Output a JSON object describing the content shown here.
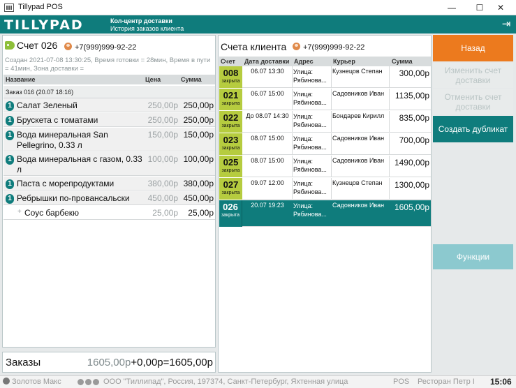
{
  "window": {
    "title": "Tillypad POS",
    "minimize": "—",
    "maximize": "☐",
    "close": "✕"
  },
  "header": {
    "logo": "TILLYPAD",
    "line1": "Кол-центр доставки",
    "line2": "История заказов клиента"
  },
  "left": {
    "bill_title": "Счет 026",
    "phone": "+7(999)999-92-22",
    "info": "Создан  2021-07-08 13:30:25, Время готовки = 28мин, Время в пути = 41мин, Зона доставки =",
    "columns": {
      "name": "Название",
      "price": "Цена",
      "sum": "Сумма"
    },
    "order_group": "Заказ 016 (20.07 18:16)",
    "items": [
      {
        "qty": "1",
        "name": "Салат Зеленый",
        "price": "250,00р",
        "sum": "250,00р"
      },
      {
        "qty": "1",
        "name": "Брускета с томатами",
        "price": "250,00р",
        "sum": "250,00р"
      },
      {
        "qty": "1",
        "name": "Вода минеральная San Pellegrino, 0.33 л",
        "price": "150,00р",
        "sum": "150,00р"
      },
      {
        "qty": "1",
        "name": "Вода минеральная с газом, 0.33 л",
        "price": "100,00р",
        "sum": "100,00р"
      },
      {
        "qty": "1",
        "name": "Паста с морепродуктами",
        "price": "380,00р",
        "sum": "380,00р"
      },
      {
        "qty": "1",
        "name": "Ребрышки по-провансальски",
        "price": "450,00р",
        "sum": "450,00р"
      }
    ],
    "modifier": {
      "plus": "+",
      "name": "Соус барбекю",
      "price": "25,00р",
      "sum": "25,00р"
    },
    "totals": {
      "label": "Заказы",
      "a": "1605,00р",
      "plus": "+",
      "b": "0,00р",
      "eq": "=",
      "total": "1605,00р"
    }
  },
  "mid": {
    "title": "Счета клиента",
    "phone": "+7(999)999-92-22",
    "columns": {
      "bill": "Счет",
      "date": "Дата доставки",
      "addr": "Адрес",
      "courier": "Курьер",
      "sum": "Сумма"
    },
    "bills": [
      {
        "num": "008",
        "state": "закрыта",
        "date": "06.07 13:30",
        "addr": "Улица: Рябинова...",
        "courier": "Кузнецов Степан",
        "sum": "300,00р"
      },
      {
        "num": "021",
        "state": "закрыта",
        "date": "06.07 15:00",
        "addr": "Улица: Рябинова...",
        "courier": "Садовников Иван",
        "sum": "1135,00р"
      },
      {
        "num": "022",
        "state": "закрыта",
        "date": "До 08.07 14:30",
        "addr": "Улица: Рябинова...",
        "courier": "Бондарев Кирилл",
        "sum": "835,00р"
      },
      {
        "num": "023",
        "state": "закрыта",
        "date": "08.07 15:00",
        "addr": "Улица: Рябинова...",
        "courier": "Садовников Иван",
        "sum": "700,00р"
      },
      {
        "num": "025",
        "state": "закрыта",
        "date": "08.07 15:00",
        "addr": "Улица: Рябинова...",
        "courier": "Садовников Иван",
        "sum": "1490,00р"
      },
      {
        "num": "027",
        "state": "закрыта",
        "date": "09.07 12:00",
        "addr": "Улица: Рябинова...",
        "courier": "Кузнецов Степан",
        "sum": "1300,00р"
      },
      {
        "num": "026",
        "state": "закрыта",
        "date": "20.07 19:23",
        "addr": "Улица: Рябинова...",
        "courier": "Садовников Иван",
        "sum": "1605,00р"
      }
    ]
  },
  "actions": {
    "back": "Назад",
    "edit": "Изменить счет доставки",
    "cancel": "Отменить счет доставки",
    "duplicate": "Создать дубликат",
    "functions": "Функции"
  },
  "status": {
    "user": "Золотов Макс",
    "company": "ООО \"Тиллипад\", Россия, 197374, Санкт-Петербург, Яхтенная улица",
    "pos": "POS",
    "restaurant": "Ресторан Петр I",
    "time": "15:06"
  },
  "colors": {
    "accent": "#0f7c7c",
    "back_button": "#ec7a1e",
    "bill_badge": "#b6cc3f"
  }
}
